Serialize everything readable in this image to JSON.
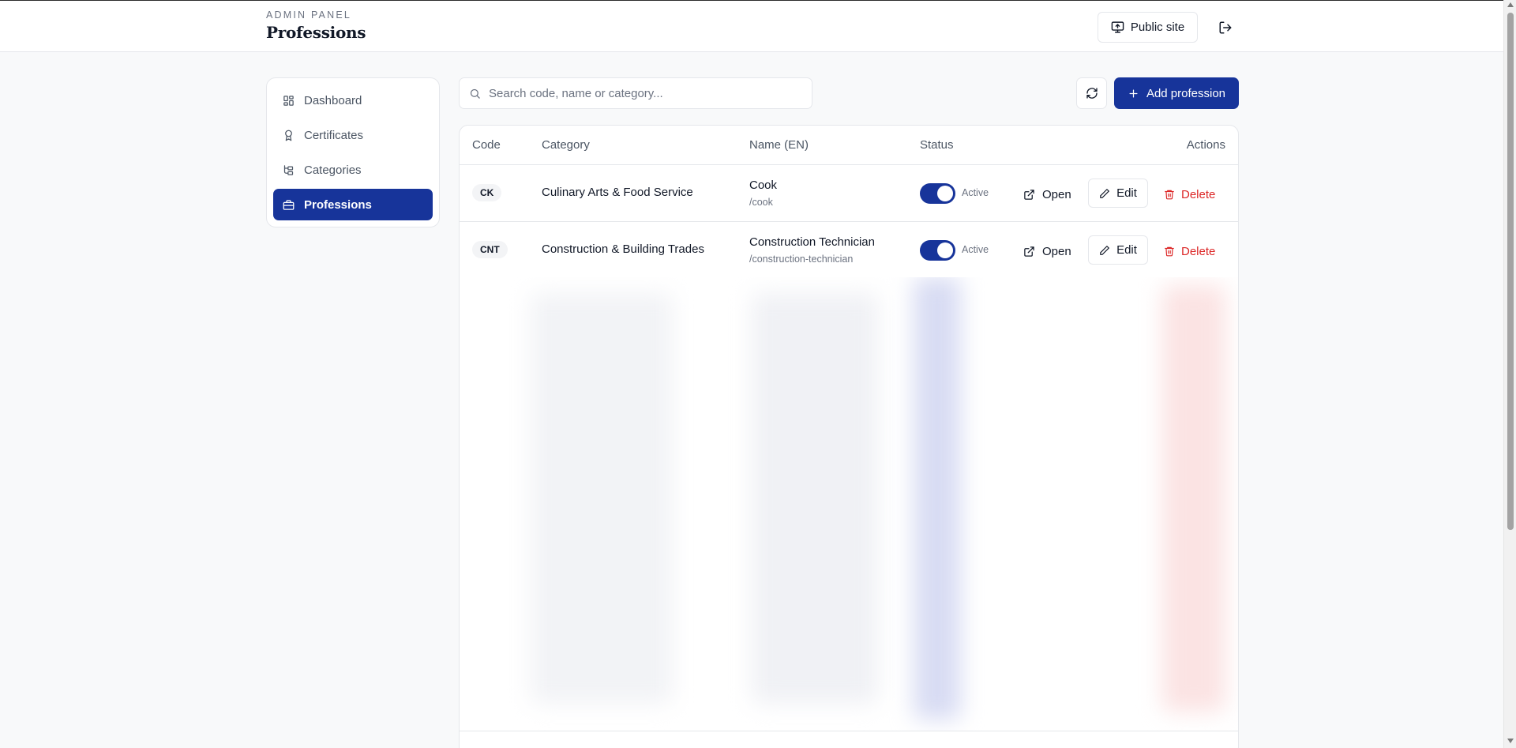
{
  "header": {
    "overline": "ADMIN PANEL",
    "title": "Professions",
    "public_site_label": "Public site",
    "public_site_icon": "monitor-icon",
    "logout_icon": "logout-icon"
  },
  "sidebar": {
    "items": [
      {
        "label": "Dashboard",
        "icon": "dashboard-icon",
        "active": false
      },
      {
        "label": "Certificates",
        "icon": "award-icon",
        "active": false
      },
      {
        "label": "Categories",
        "icon": "tree-icon",
        "active": false
      },
      {
        "label": "Professions",
        "icon": "briefcase-icon",
        "active": true
      }
    ]
  },
  "toolbar": {
    "search_placeholder": "Search code, name or category...",
    "search_value": "",
    "refresh_icon": "refresh-icon",
    "add_label": "Add profession"
  },
  "table": {
    "columns": [
      "Code",
      "Category",
      "Name (EN)",
      "Status",
      "Actions"
    ],
    "rows": [
      {
        "code": "CK",
        "category": "Culinary Arts & Food Service",
        "name": "Cook",
        "slug": "/cook",
        "status": "Active",
        "enabled": true
      },
      {
        "code": "CNT",
        "category": "Construction & Building Trades",
        "name": "Construction Technician",
        "slug": "/construction-technician",
        "status": "Active",
        "enabled": true
      }
    ],
    "actions": {
      "open": "Open",
      "edit": "Edit",
      "delete": "Delete"
    }
  },
  "colors": {
    "primary": "#17349a",
    "danger": "#dc2626",
    "border": "#e5e7eb",
    "background": "#f8f9fa"
  }
}
